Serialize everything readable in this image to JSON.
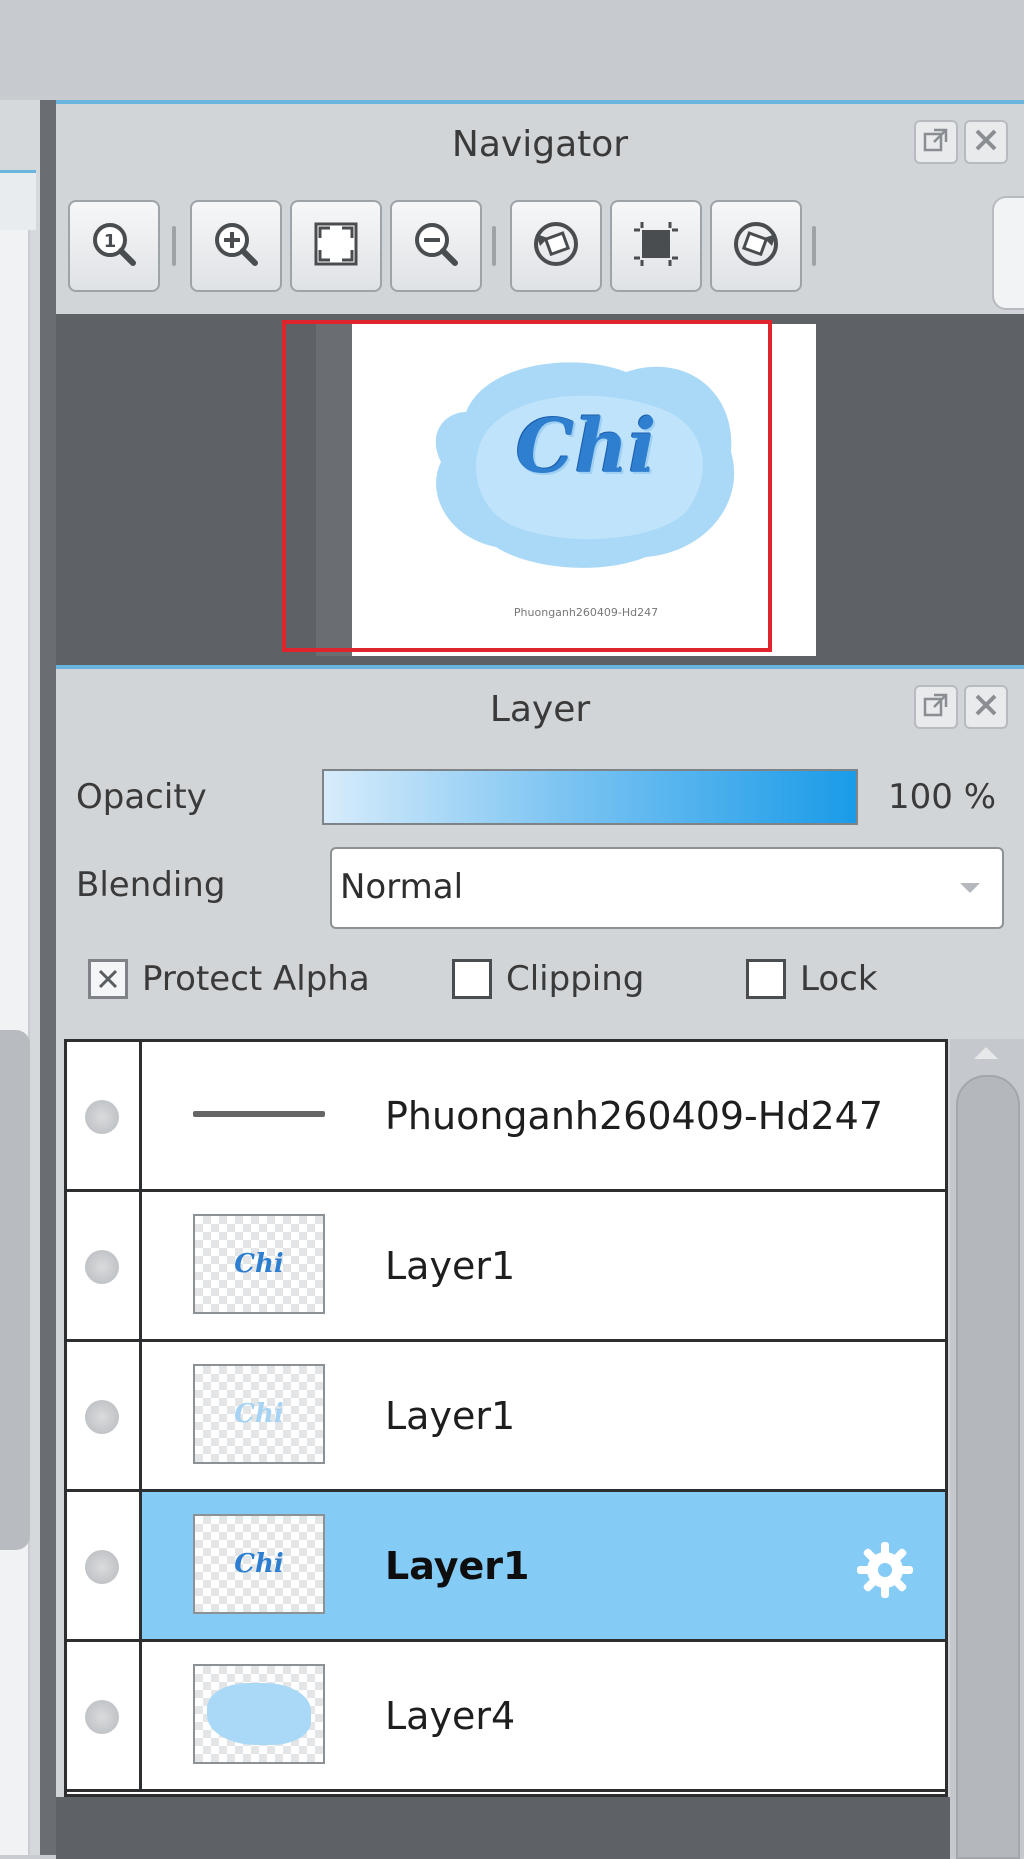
{
  "navigator": {
    "title": "Navigator",
    "toolbar": [
      "zoom-actual-icon",
      "zoom-in-icon",
      "fit-window-icon",
      "zoom-out-icon",
      "rotate-left-icon",
      "fit-frame-icon",
      "rotate-right-icon"
    ],
    "preview": {
      "art_text": "Chi",
      "caption": "Phuonganh260409-Hd247"
    }
  },
  "layer_panel": {
    "title": "Layer",
    "opacity_label": "Opacity",
    "opacity_value": "100 %",
    "opacity_fraction": 1.0,
    "blending_label": "Blending",
    "blending_value": "Normal",
    "protect_alpha_label": "Protect Alpha",
    "protect_alpha_checked": true,
    "clipping_label": "Clipping",
    "clipping_checked": false,
    "lock_label": "Lock",
    "lock_checked": false,
    "layers": [
      {
        "name": "Phuonganh260409-Hd247",
        "thumb": "text-line",
        "selected": false
      },
      {
        "name": "Layer1",
        "thumb": "chi-text",
        "selected": false
      },
      {
        "name": "Layer1",
        "thumb": "chi-text-faint",
        "selected": false
      },
      {
        "name": "Layer1",
        "thumb": "chi-text",
        "selected": true
      },
      {
        "name": "Layer4",
        "thumb": "blue-blob",
        "selected": false
      }
    ]
  },
  "colors": {
    "accent": "#6ab4e0",
    "selected_row": "#84cbf5",
    "nav_frame": "#e0242b",
    "art_blue": "#2f7fd0",
    "cloud_blue": "#a9d9f7"
  }
}
